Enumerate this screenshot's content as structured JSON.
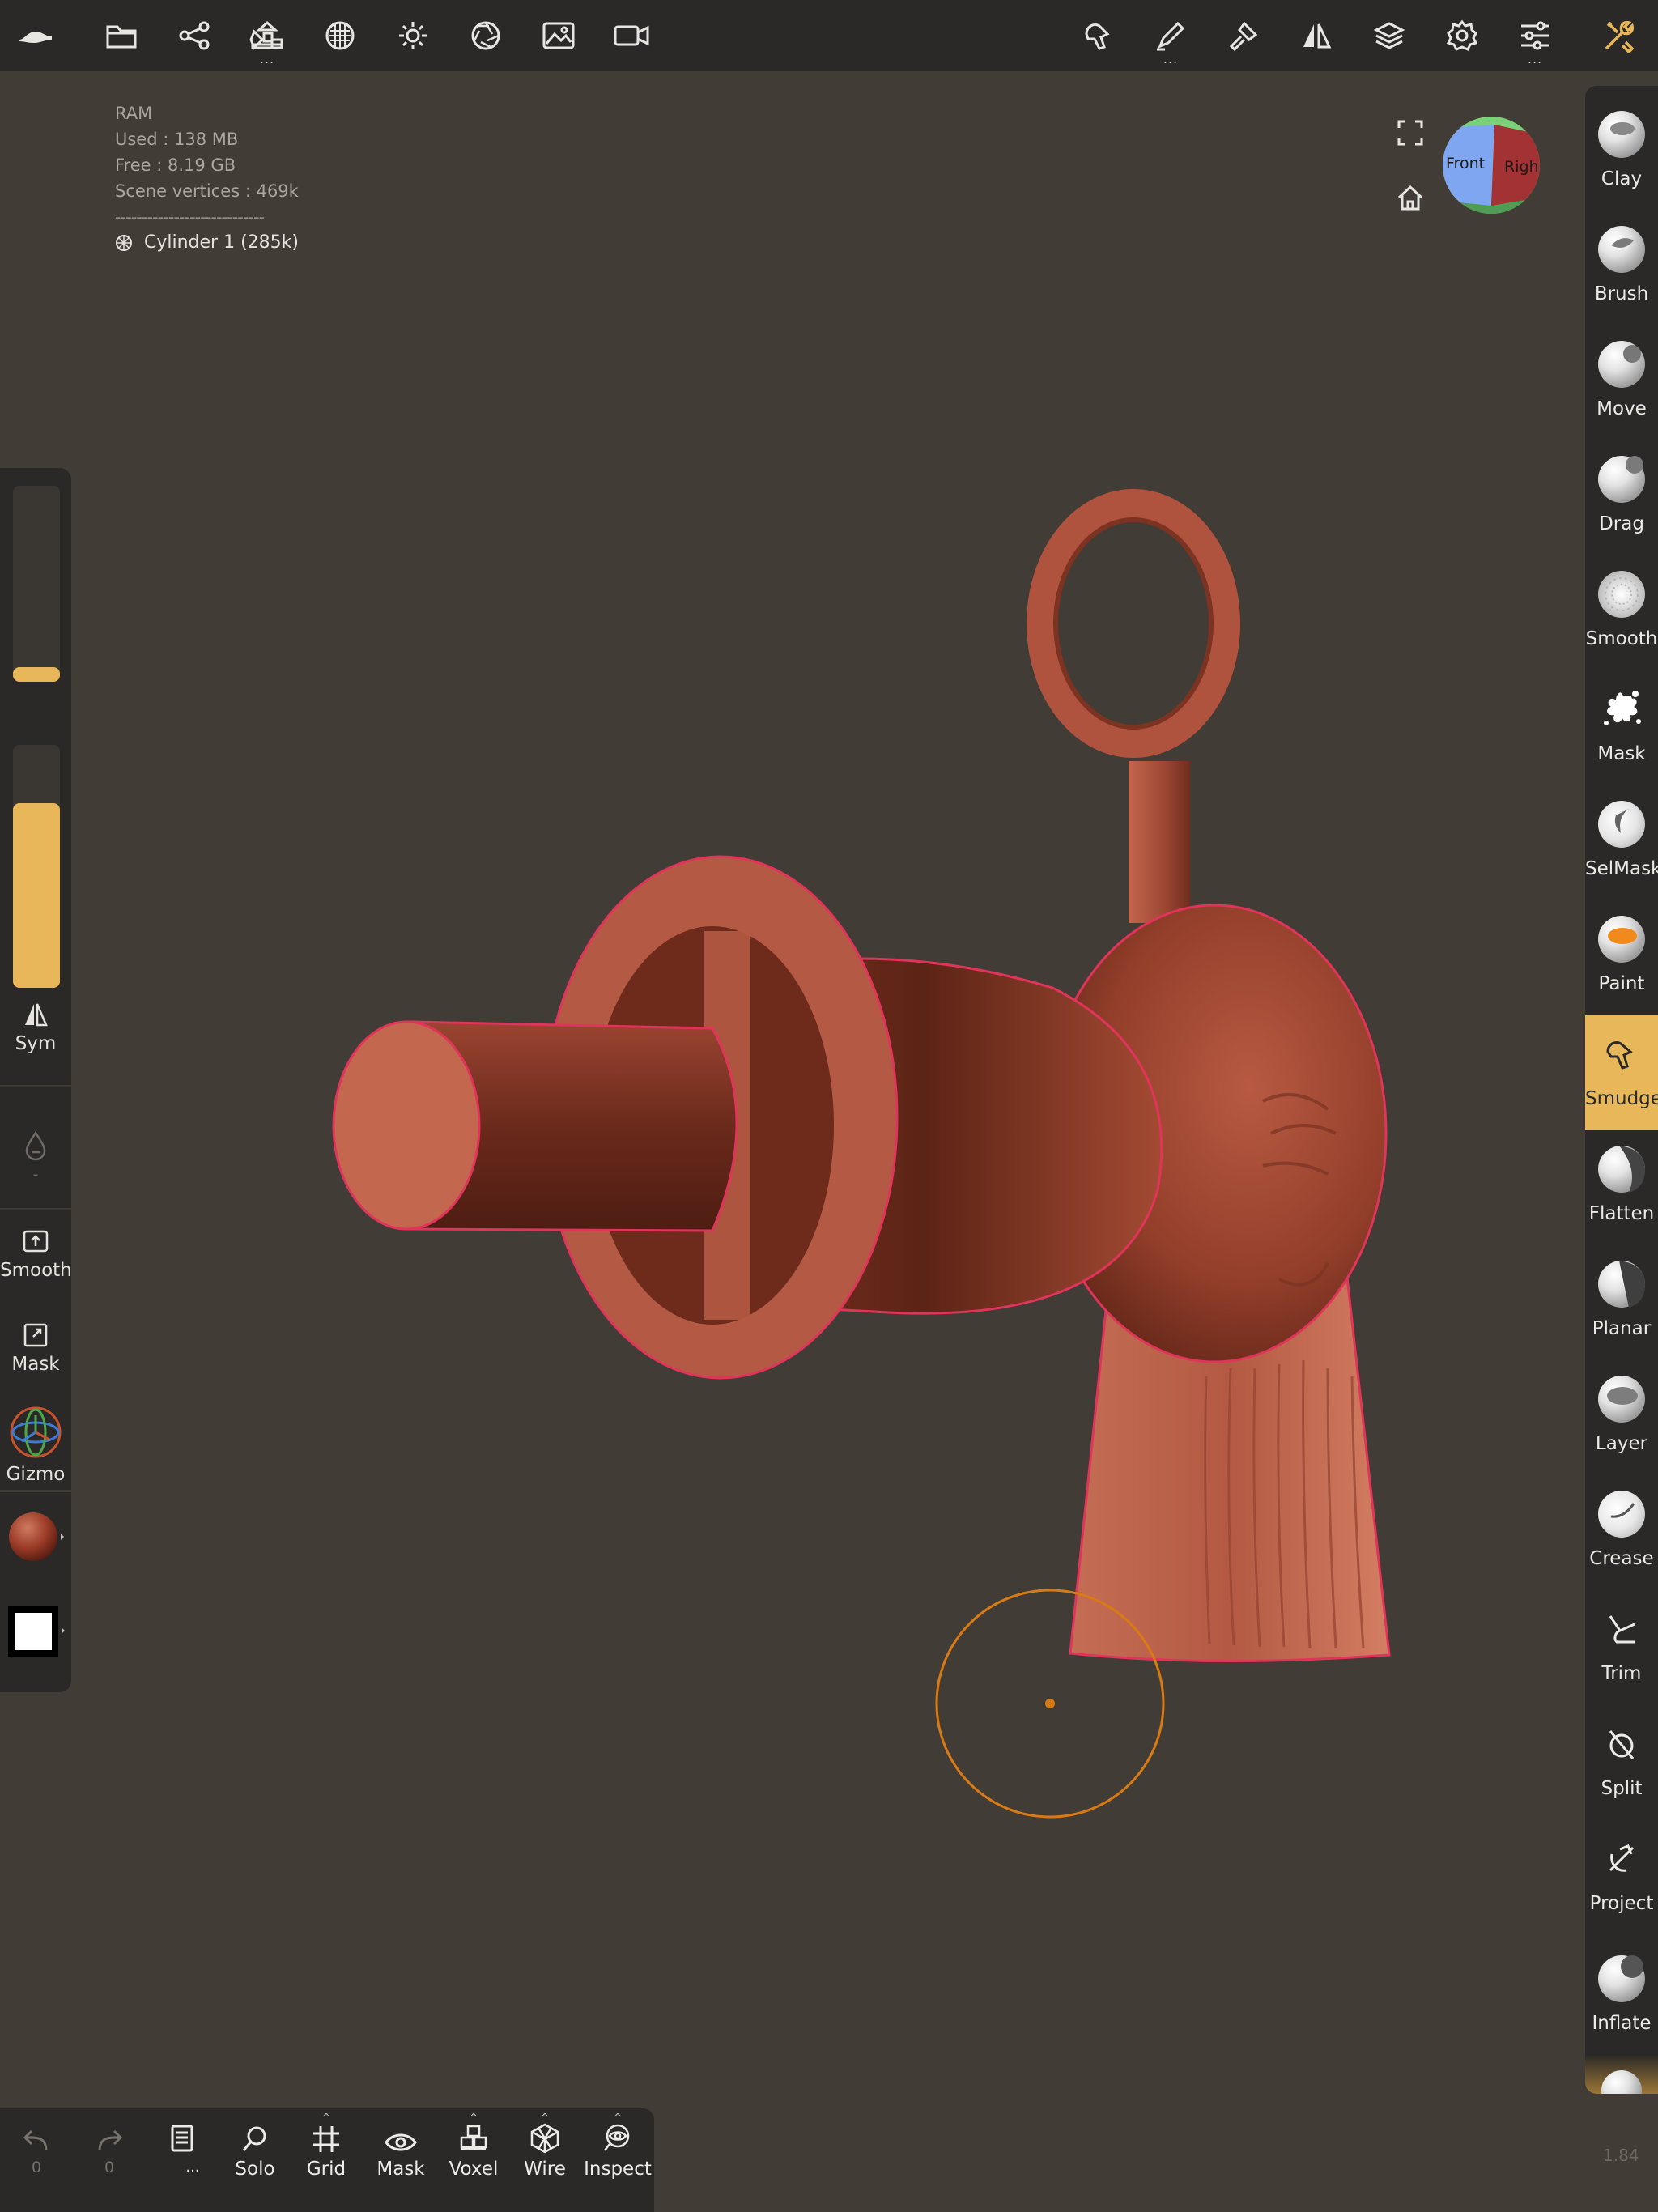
{
  "topbar": {
    "left_icons": [
      "app-logo-icon",
      "folder-icon",
      "scene-graph-icon",
      "primitives-icon",
      "material-icon",
      "light-icon",
      "camera-aperture-icon",
      "background-image-icon",
      "video-camera-icon"
    ],
    "right_icons": [
      "sculpt-tool-icon",
      "stroke-icon",
      "painting-icon",
      "symmetry-icon",
      "layers-icon",
      "settings-icon",
      "sliders-icon",
      "tools-icon"
    ]
  },
  "info": {
    "ram_label": "RAM",
    "used": "Used : 138 MB",
    "free": "Free : 8.19 GB",
    "vertices": "Scene vertices : 469k",
    "separator": "----------------------------",
    "object": "Cylinder 1 (285k)"
  },
  "view_cube": {
    "front_label": "Front",
    "right_label": "Righ",
    "colors": {
      "front": "#7fa6f0",
      "right": "#a33234",
      "top": "#7ad17a",
      "bottom": "#4f9d54"
    }
  },
  "left_panel": {
    "radius_level": 0.0,
    "intensity_level": 0.76,
    "sym_label": "Sym",
    "dash": "-",
    "smooth_label": "Smooth",
    "mask_label": "Mask",
    "gizmo_label": "Gizmo",
    "accent": "#e8b759"
  },
  "tools": [
    {
      "label": "Clay",
      "icon": "clay-sphere-icon"
    },
    {
      "label": "Brush",
      "icon": "brush-sphere-icon"
    },
    {
      "label": "Move",
      "icon": "move-sphere-icon"
    },
    {
      "label": "Drag",
      "icon": "drag-sphere-icon"
    },
    {
      "label": "Smooth",
      "icon": "smooth-sphere-icon"
    },
    {
      "label": "Mask",
      "icon": "mask-splat-icon"
    },
    {
      "label": "SelMask",
      "icon": "selmask-sphere-icon"
    },
    {
      "label": "Paint",
      "icon": "paint-sphere-icon"
    },
    {
      "label": "Smudge",
      "icon": "smudge-icon",
      "active": true
    },
    {
      "label": "Flatten",
      "icon": "flatten-sphere-icon"
    },
    {
      "label": "Planar",
      "icon": "planar-sphere-icon"
    },
    {
      "label": "Layer",
      "icon": "layer-sphere-icon"
    },
    {
      "label": "Crease",
      "icon": "crease-sphere-icon"
    },
    {
      "label": "Trim",
      "icon": "trim-icon"
    },
    {
      "label": "Split",
      "icon": "split-icon"
    },
    {
      "label": "Project",
      "icon": "project-icon"
    },
    {
      "label": "Inflate",
      "icon": "inflate-sphere-icon"
    }
  ],
  "bottom": {
    "undo_count": "0",
    "redo_count": "0",
    "more_dots": "...",
    "solo": "Solo",
    "grid": "Grid",
    "mask": "Mask",
    "voxel": "Voxel",
    "wire": "Wire",
    "inspect": "Inspect"
  },
  "version": "1.84",
  "colors": {
    "background": "#423c37",
    "panel": "#2b2927",
    "accent": "#e8b759",
    "model": "#b45a44",
    "selection_outline": "#e0345a",
    "cursor": "#d97b14"
  }
}
